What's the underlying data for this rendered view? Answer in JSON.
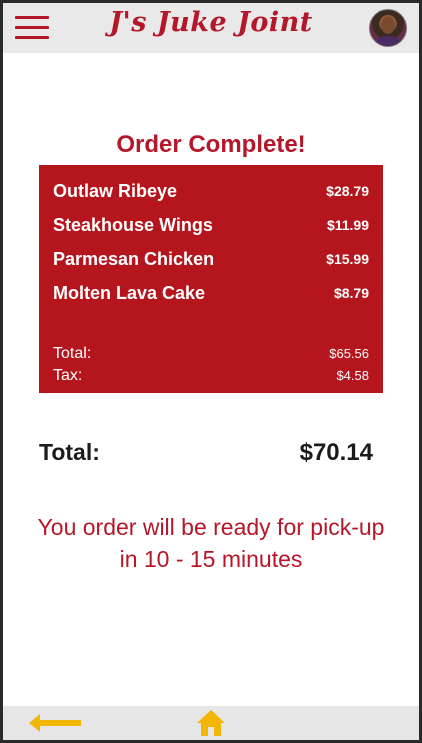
{
  "header": {
    "title": "J's Juke Joint",
    "menu_icon": "hamburger-menu-icon",
    "avatar_icon": "user-avatar"
  },
  "order": {
    "heading": "Order Complete!",
    "items": [
      {
        "name": "Outlaw Ribeye",
        "price": "$28.79"
      },
      {
        "name": "Steakhouse Wings",
        "price": "$11.99"
      },
      {
        "name": "Parmesan Chicken",
        "price": "$15.99"
      },
      {
        "name": "Molten Lava Cake",
        "price": "$8.79"
      }
    ],
    "subtotal_label": "Total:",
    "subtotal_value": "$65.56",
    "tax_label": "Tax:",
    "tax_value": "$4.58",
    "grand_total_label": "Total:",
    "grand_total_value": "$70.14",
    "ready_message": "You order will be ready for pick-up in 10 - 15 minutes"
  },
  "footer": {
    "back_icon": "back-arrow-icon",
    "home_icon": "home-icon"
  },
  "colors": {
    "brand_red": "#b5172a",
    "receipt_red": "#b5151d",
    "accent_yellow": "#f2b705",
    "bar_gray": "#e9e9e9"
  }
}
